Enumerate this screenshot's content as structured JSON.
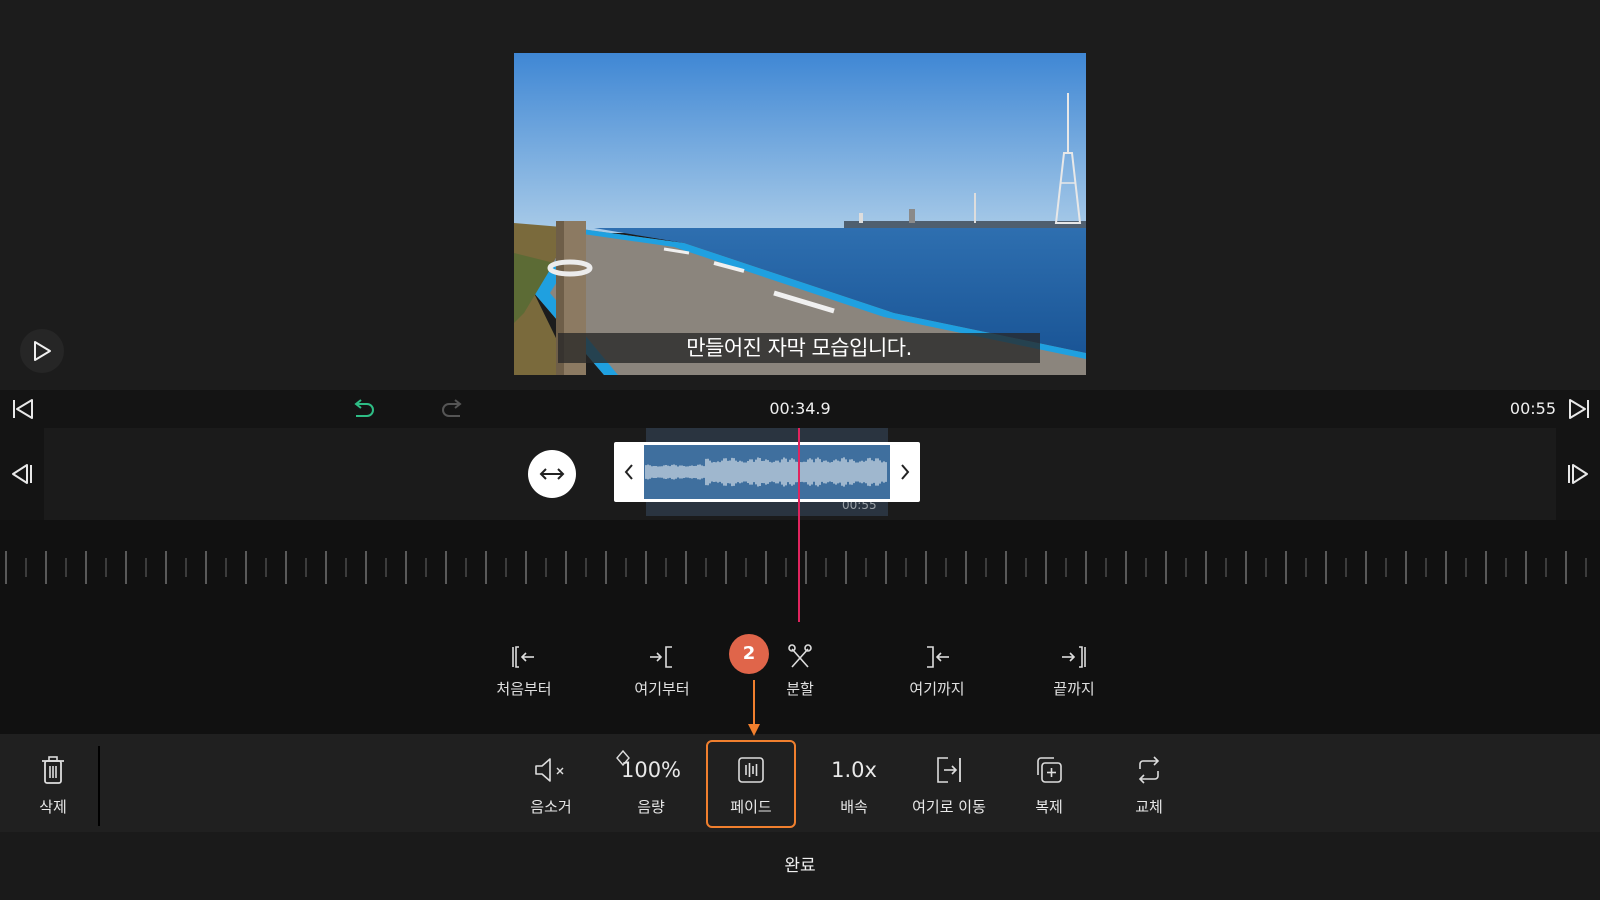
{
  "preview": {
    "subtitle": "만들어진 자막 모습입니다."
  },
  "timeline": {
    "current_time": "00:34.9",
    "total_time": "00:55",
    "clip_duration": "00:55",
    "playhead_color": "#e0245e",
    "undo_color": "#2ebd85"
  },
  "edit_actions": [
    {
      "label": "처음부터",
      "icon": "trim-from-start-icon"
    },
    {
      "label": "여기부터",
      "icon": "trim-from-here-icon"
    },
    {
      "label": "분할",
      "icon": "split-scissors-icon"
    },
    {
      "label": "여기까지",
      "icon": "trim-to-here-icon"
    },
    {
      "label": "끝까지",
      "icon": "trim-to-end-icon"
    }
  ],
  "step_badge": "2",
  "toolbar": {
    "delete_label": "삭제",
    "mute_label": "음소거",
    "volume_value": "100%",
    "volume_label": "음량",
    "fade_label": "페이드",
    "speed_value": "1.0x",
    "speed_label": "배속",
    "move_here_label": "여기로 이동",
    "duplicate_label": "복제",
    "replace_label": "교체",
    "highlight_color": "#f07f2e"
  },
  "footer": {
    "done_label": "완료"
  }
}
